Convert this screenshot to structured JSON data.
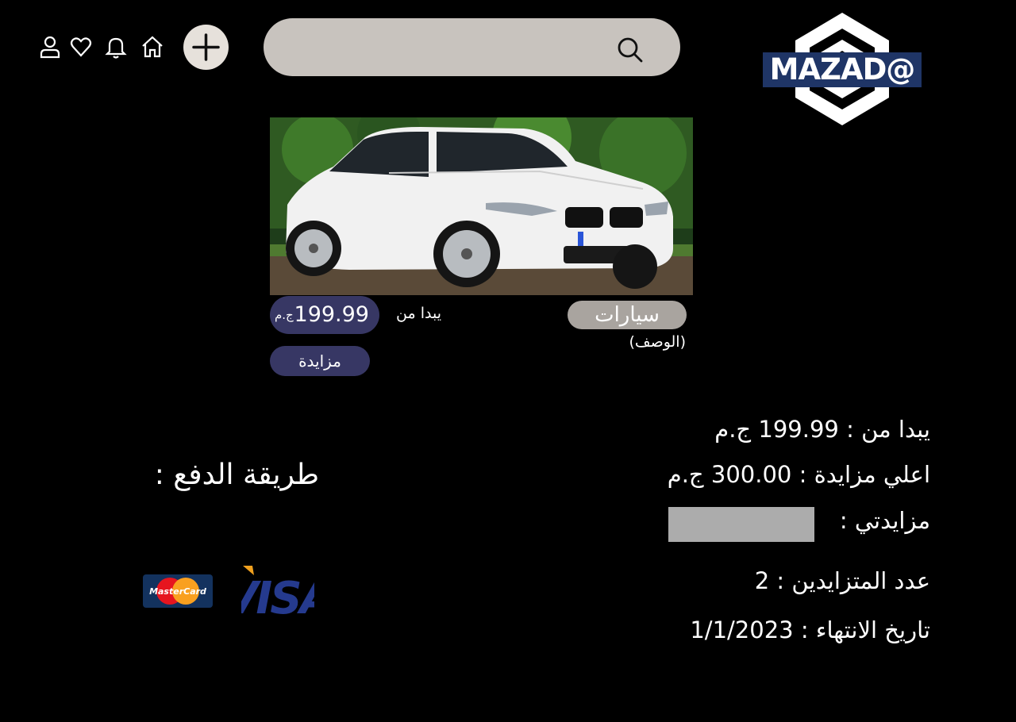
{
  "header": {
    "logo_text": "MAZAD@",
    "search_placeholder": "",
    "icons": [
      "user-icon",
      "heart-icon",
      "bell-icon",
      "home-icon",
      "plus-icon",
      "search-icon"
    ]
  },
  "listing": {
    "image_alt": "white BMW sedan",
    "price_value": "199.99",
    "price_currency": "ج.م",
    "starting_label": "يبدا من",
    "category": "سيارات",
    "description_label": "(الوصف)",
    "bid_button_label": "مزايدة"
  },
  "details": {
    "starting_from": "يبدا من : 199.99 ج.م",
    "highest_bid": "اعلي مزايدة : 300.00 ج.م",
    "my_bid_label": "مزايدتي :",
    "my_bid_value": "",
    "bidders_count": "عدد المتزايدين : 2",
    "end_date": "تاريخ الانتهاء : 1/1/2023"
  },
  "payment": {
    "title": "طريقة الدفع :",
    "methods": [
      {
        "name": "MasterCard",
        "text_primary": "Master",
        "text_secondary": "Card"
      },
      {
        "name": "VISA",
        "text": "VISA"
      }
    ]
  },
  "colors": {
    "background": "#000000",
    "pill": "#373764",
    "category_tag": "#a9a49f",
    "search": "#c8c3be",
    "logo_blue": "#1f3566"
  }
}
